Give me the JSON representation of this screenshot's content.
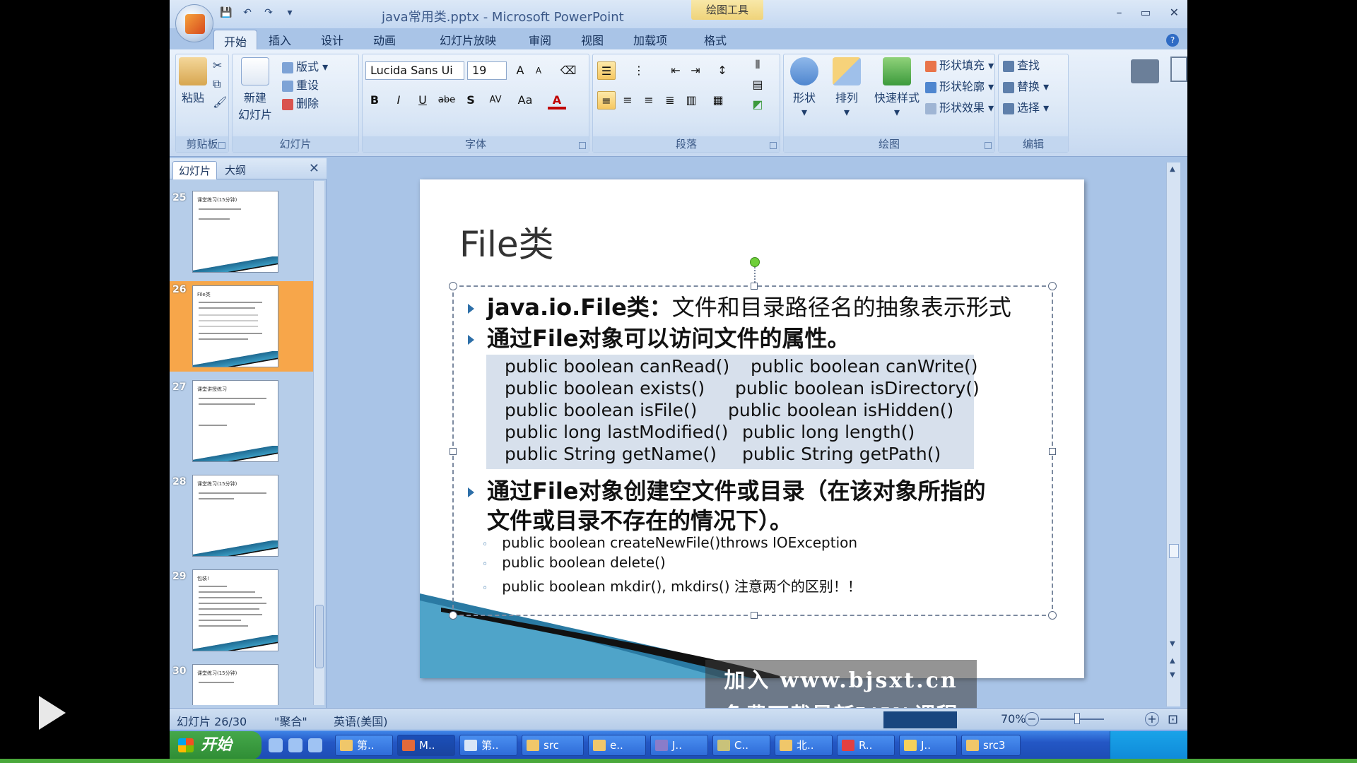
{
  "window": {
    "title": "java常用类.pptx - Microsoft PowerPoint",
    "contextual_label": "绘图工具",
    "controls": [
      "–",
      "▭",
      "✕"
    ]
  },
  "tabs": [
    "开始",
    "插入",
    "设计",
    "动画",
    "幻灯片放映",
    "审阅",
    "视图",
    "加载项",
    "格式"
  ],
  "ribbon": {
    "clipboard": {
      "paste": "粘贴",
      "label": "剪贴板"
    },
    "slides": {
      "new_slide_1": "新建",
      "new_slide_2": "幻灯片",
      "layout": "版式",
      "reset": "重设",
      "delete": "删除",
      "label": "幻灯片"
    },
    "font": {
      "family": "Lucida Sans Ui",
      "size": "19",
      "label": "字体",
      "bold": "B",
      "italic": "I",
      "underline": "U",
      "strike": "abe",
      "shadow": "S",
      "spacing": "AV",
      "case": "Aa",
      "color": "A",
      "grow": "A",
      "shrink": "A"
    },
    "paragraph": {
      "label": "段落"
    },
    "drawing": {
      "shapes": "形状",
      "arrange": "排列",
      "quick_styles": "快速样式",
      "fill": "形状填充",
      "outline": "形状轮廓",
      "effects": "形状效果",
      "label": "绘图"
    },
    "editing": {
      "find": "查找",
      "replace": "替换",
      "select": "选择",
      "label": "编辑"
    }
  },
  "pane": {
    "tab_slides": "幻灯片",
    "tab_outline": "大纲",
    "close": "✕",
    "thumbs": [
      {
        "num": "25",
        "title": "课堂练习(15分钟)"
      },
      {
        "num": "26",
        "title": "File类"
      },
      {
        "num": "27",
        "title": "课堂讲授练习"
      },
      {
        "num": "28",
        "title": "课堂练习(15分钟)"
      },
      {
        "num": "29",
        "title": "包装!"
      },
      {
        "num": "30",
        "title": "课堂练习(15分钟)"
      }
    ]
  },
  "slide": {
    "title": "File类",
    "bullet1_bold": "java.io.File类：",
    "bullet1_rest": "文件和目录路径名的抽象表示形式",
    "bullet2": "通过File对象可以访问文件的属性。",
    "code": [
      [
        "public boolean canRead()",
        "public boolean canWrite()"
      ],
      [
        "public boolean exists()",
        "public boolean isDirectory()"
      ],
      [
        "public boolean isFile()",
        "public boolean isHidden()"
      ],
      [
        "public long lastModified()",
        "public long length()"
      ],
      [
        "public String getName()",
        "public String getPath()"
      ]
    ],
    "bullet3_line1": "通过File对象创建空文件或目录（在该对象所指的",
    "bullet3_line2": "文件或目录不存在的情况下）。",
    "sub1": "public boolean  createNewFile()throws IOException",
    "sub2": "public boolean  delete()",
    "sub3": "public boolean  mkdir(),   mkdirs()     注意两个的区别！！"
  },
  "watermark": {
    "line1": "加入 www.bjsxt.cn",
    "line2": "免费下载最新JAVA课程"
  },
  "status": {
    "slide_counter": "幻灯片 26/30",
    "theme": "\"聚合\"",
    "language": "英语(美国)",
    "zoom": "70%"
  },
  "taskbar": {
    "start": "开始",
    "tasks": [
      "第..",
      "M..",
      "第..",
      "src",
      "e..",
      "J..",
      "C..",
      "北..",
      "R..",
      "J..",
      "src3"
    ]
  },
  "colors": {
    "ribbon_bg": "#d3e2f4",
    "accent_orange": "#f7a64a",
    "bullet_blue": "#2d6fa8",
    "taskbar_blue": "#2457c5"
  }
}
